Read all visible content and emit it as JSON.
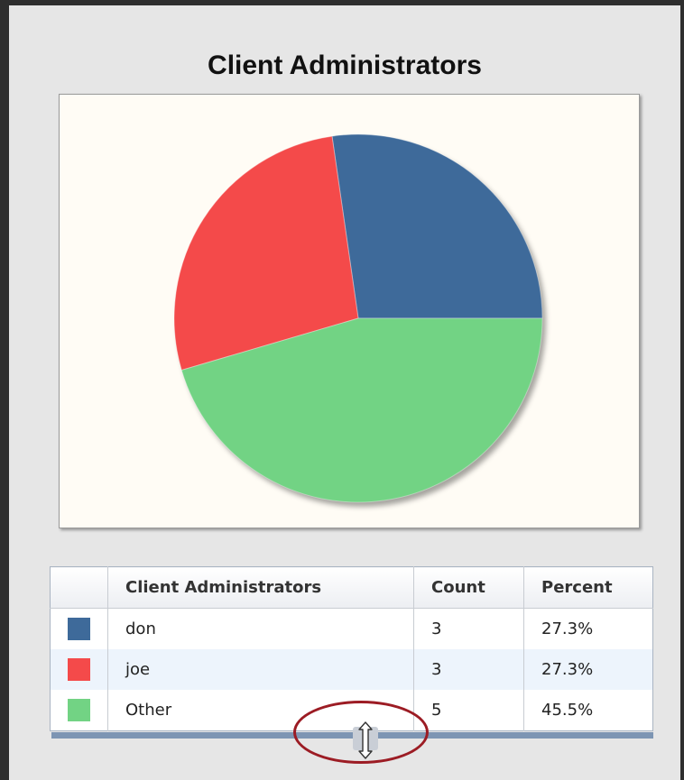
{
  "chart_data": {
    "type": "pie",
    "title": "Client Administrators",
    "categories": [
      "don",
      "joe",
      "Other"
    ],
    "values": [
      3,
      3,
      5
    ],
    "percents": [
      "27.3%",
      "27.3%",
      "45.5%"
    ],
    "colors": [
      "#3e6a9a",
      "#f44a4a",
      "#72d384"
    ]
  },
  "table": {
    "headers": [
      "",
      "Client Administrators",
      "Count",
      "Percent"
    ],
    "rows": [
      {
        "name": "don",
        "count": "3",
        "percent": "27.3%",
        "color": "#3e6a9a"
      },
      {
        "name": "joe",
        "count": "3",
        "percent": "27.3%",
        "color": "#f44a4a"
      },
      {
        "name": "Other",
        "count": "5",
        "percent": "45.5%",
        "color": "#72d384"
      }
    ]
  },
  "resize_handle": {
    "icon": "resize-vertical-icon"
  },
  "annotation": {
    "color": "#9c1c24"
  }
}
